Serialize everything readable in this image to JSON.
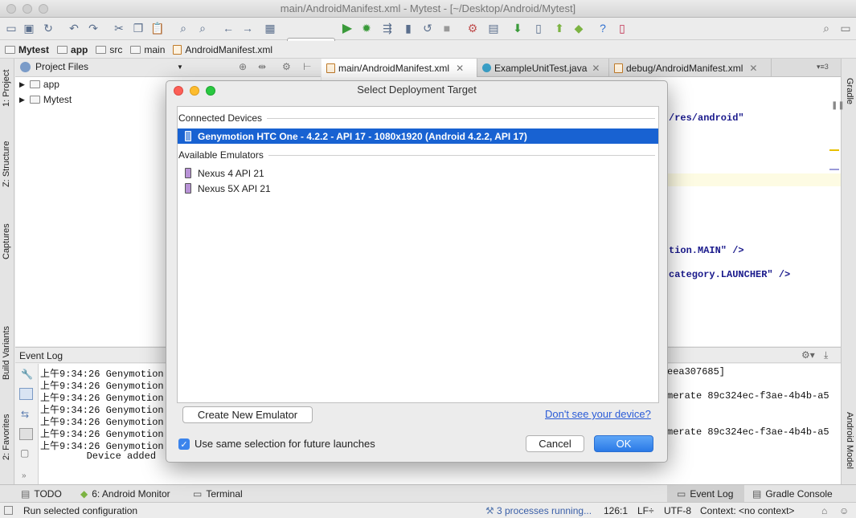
{
  "window": {
    "title": "main/AndroidManifest.xml - Mytest - [~/Desktop/Android/Mytest]"
  },
  "toolbar": {
    "run_config": "app"
  },
  "breadcrumbs": [
    "Mytest",
    "app",
    "src",
    "main",
    "AndroidManifest.xml"
  ],
  "left_strip": {
    "project": "1: Project",
    "structure": "Z: Structure",
    "captures": "Captures",
    "build_variants": "Build Variants",
    "favorites": "2: Favorites"
  },
  "right_strip": {
    "gradle": "Gradle",
    "android_model": "Android Model"
  },
  "project": {
    "dropdown": "Project Files",
    "tree": [
      "app",
      "Mytest"
    ]
  },
  "editor": {
    "tabs": [
      "main/AndroidManifest.xml",
      "ExampleUnitTest.java",
      "debug/AndroidManifest.xml"
    ],
    "overflow": "3",
    "code": [
      "/res/android\"",
      "tion.MAIN\" />",
      "category.LAUNCHER\" />"
    ]
  },
  "event_log": {
    "title": "Event Log",
    "lines": [
      "上午9:34:26 Genymotion:",
      "上午9:34:26 Genymotion:",
      "上午9:34:26 Genymotion:",
      "上午9:34:26 Genymotion:",
      "上午9:34:26 Genymotion:",
      "上午9:34:26 Genymotion:",
      "上午9:34:26 Genymotion",
      "        Device added"
    ],
    "right_fragments": [
      "eea307685]",
      "merate 89c324ec-f3ae-4b4b-a5",
      "merate 89c324ec-f3ae-4b4b-a5"
    ]
  },
  "bottom_tabs": {
    "todo": "TODO",
    "android_monitor": "6: Android Monitor",
    "terminal": "Terminal",
    "event_log": "Event Log",
    "gradle_console": "Gradle Console"
  },
  "status": {
    "message": "Run selected configuration",
    "processes": "3 processes running...",
    "position": "126:1",
    "line_sep": "LF÷",
    "encoding": "UTF-8",
    "context": "Context: <no context>"
  },
  "dialog": {
    "title": "Select Deployment Target",
    "connected_header": "Connected Devices",
    "connected": [
      "Genymotion HTC One - 4.2.2 - API 17 - 1080x1920 (Android 4.2.2, API 17)"
    ],
    "emulators_header": "Available Emulators",
    "emulators": [
      "Nexus 4 API 21",
      "Nexus 5X API 21"
    ],
    "create_button": "Create New Emulator",
    "help_link": "Don't see your device?",
    "checkbox_label": "Use same selection for future launches",
    "checkbox_checked": true,
    "cancel": "Cancel",
    "ok": "OK"
  }
}
